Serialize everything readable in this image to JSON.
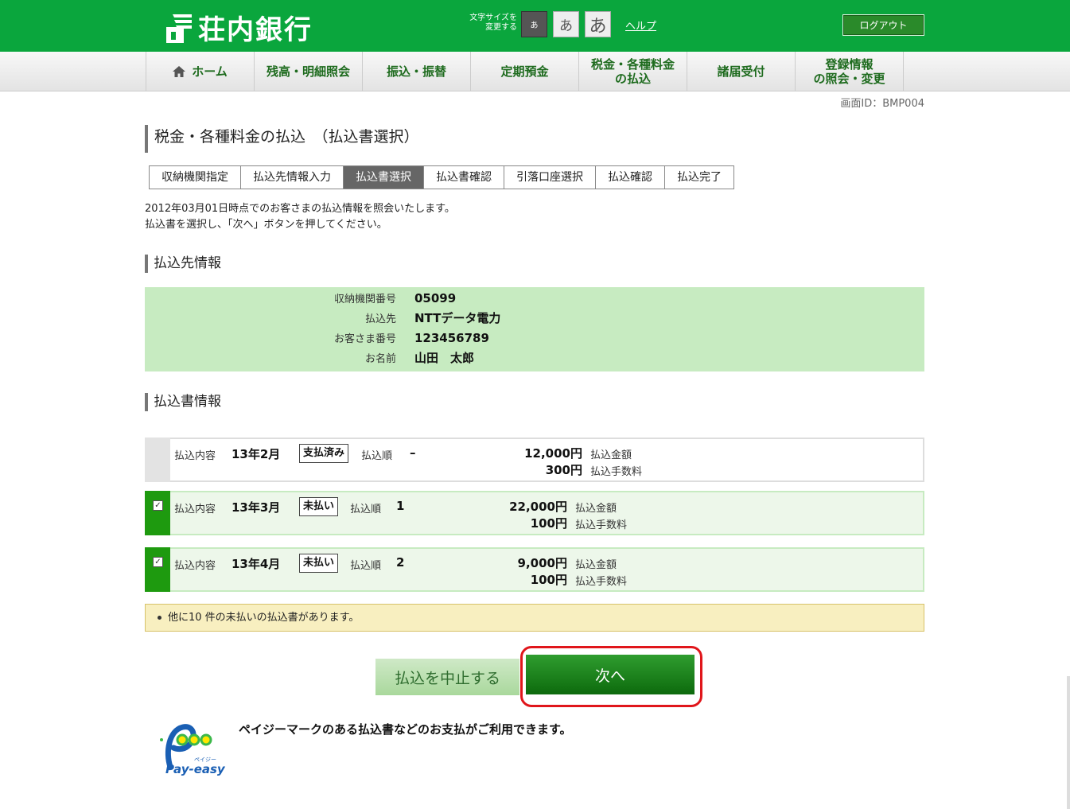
{
  "header": {
    "bank_name": "荘内銀行",
    "font_size_label_1": "文字サイズを",
    "font_size_label_2": "変更する",
    "font_small": "あ",
    "font_medium": "あ",
    "font_large": "あ",
    "help": "ヘルプ",
    "logout": "ログアウト",
    "brand_color": "#0aa63d"
  },
  "nav": {
    "items": [
      {
        "label": "ホーム"
      },
      {
        "label": "残高・明細照会"
      },
      {
        "label": "振込・振替"
      },
      {
        "label": "定期預金"
      },
      {
        "label_1": "税金・各種料金",
        "label_2": "の払込"
      },
      {
        "label": "諸届受付"
      },
      {
        "label_1": "登録情報",
        "label_2": "の照会・変更"
      }
    ]
  },
  "screen_id": "画面ID：BMP004",
  "page_title": "税金・各種料金の払込　（払込書選択）",
  "steps": [
    "収納機関指定",
    "払込先情報入力",
    "払込書選択",
    "払込書確認",
    "引落口座選択",
    "払込確認",
    "払込完了"
  ],
  "intro": {
    "line1": "2012年03月01日時点でのお客さまの払込情報を照会いたします。",
    "line2": "払込書を選択し、「次へ」ボタンを押してください。"
  },
  "payee_section": {
    "title": "払込先情報",
    "rows": [
      {
        "label": "収納機関番号",
        "value": "05099"
      },
      {
        "label": "払込先",
        "value": "NTTデータ電力"
      },
      {
        "label": "お客さま番号",
        "value": "123456789"
      },
      {
        "label": "お名前",
        "value": "山田　太郎"
      }
    ]
  },
  "bill_section": {
    "title": "払込書情報",
    "content_label": "払込内容",
    "order_label": "払込順",
    "amount_label": "払込金額",
    "fee_label": "払込手数料",
    "bills": [
      {
        "month": "13年2月",
        "status": "支払済み",
        "order": "–",
        "amount": "12,000円",
        "fee": "300円",
        "checked": false
      },
      {
        "month": "13年3月",
        "status": "未払い",
        "order": "1",
        "amount": "22,000円",
        "fee": "100円",
        "checked": true
      },
      {
        "month": "13年4月",
        "status": "未払い",
        "order": "2",
        "amount": "9,000円",
        "fee": "100円",
        "checked": true
      }
    ]
  },
  "notice": "他に10 件の未払いの払込書があります。",
  "buttons": {
    "cancel": "払込を中止する",
    "next": "次へ"
  },
  "payeasy": {
    "logo_text": "Pay-easy",
    "logo_kana": "ペイジー",
    "message": "ペイジーマークのある払込書などのお支払がご利用できます。"
  }
}
